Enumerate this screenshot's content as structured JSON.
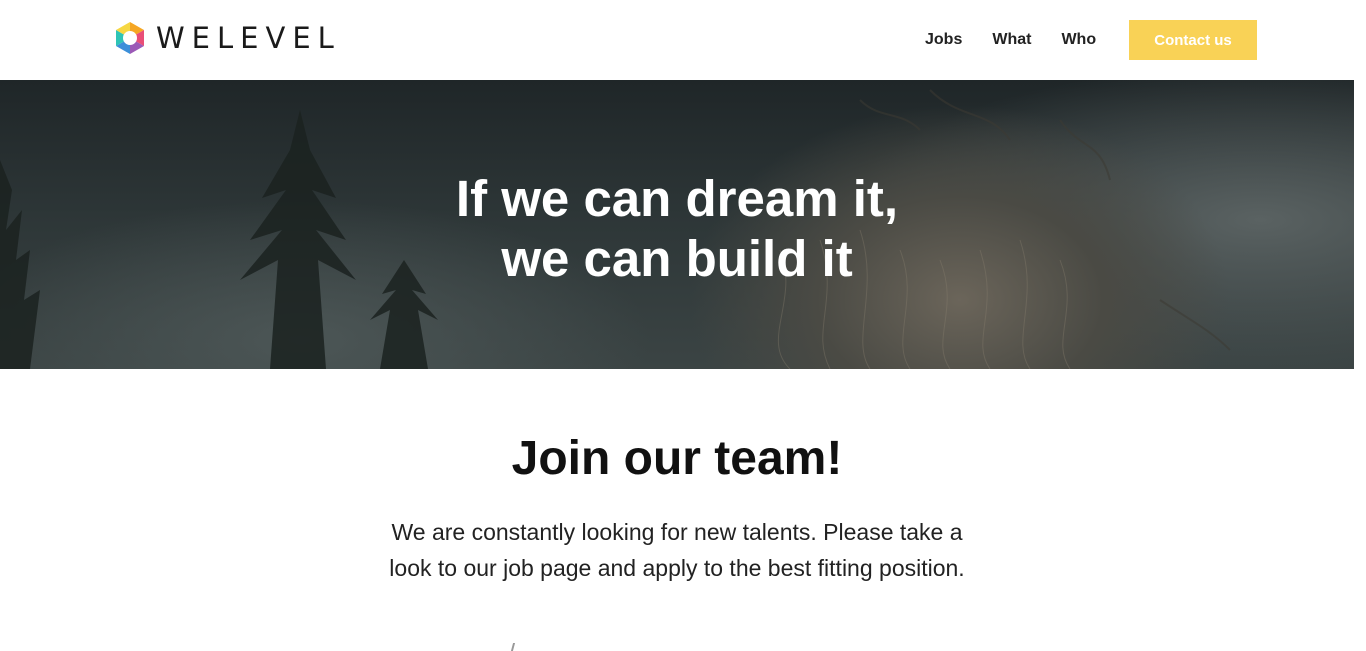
{
  "header": {
    "logo_text": "WELEVEL",
    "nav": [
      {
        "label": "Jobs"
      },
      {
        "label": "What"
      },
      {
        "label": "Who"
      }
    ],
    "contact_label": "Contact us",
    "accent_color": "#f9d256"
  },
  "hero": {
    "line1": "If we can dream it,",
    "line2": "we can build it"
  },
  "join": {
    "title": "Join our team!",
    "line1": "We are constantly looking for new talents. Please take a",
    "line2": "look to our job page and apply to the best fitting position."
  }
}
